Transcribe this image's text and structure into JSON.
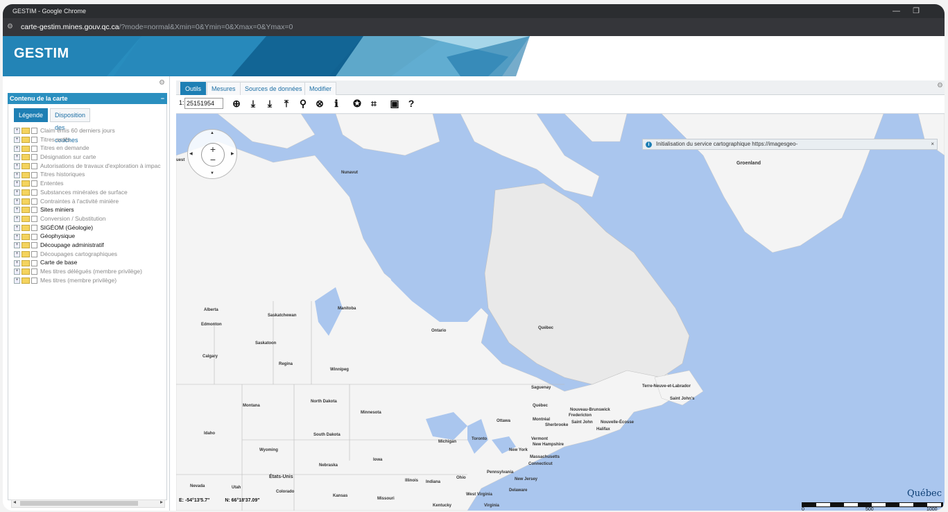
{
  "window": {
    "title": "GESTIM - Google Chrome",
    "minimize_icon": "minimize-icon",
    "restore_icon": "restore-icon"
  },
  "address": {
    "host": "carte-gestim.mines.gouv.qc.ca",
    "path": "/?mode=normal&Xmin=0&Ymin=0&Xmax=0&Ymax=0"
  },
  "banner": {
    "brand": "GESTIM",
    "colors": {
      "dark": "#0f5f8e",
      "mid": "#2a8fbf",
      "light": "#7fc6e2"
    }
  },
  "left_panel": {
    "title": "Contenu de la carte",
    "collapse_label": "−",
    "tabs": [
      {
        "label": "Légende",
        "active": true
      },
      {
        "label": "Disposition des couches",
        "active": false
      }
    ],
    "layers": [
      {
        "label": "Claim émis 60 derniers jours",
        "active": false
      },
      {
        "label": "Titres actifs",
        "active": false
      },
      {
        "label": "Titres en demande",
        "active": false
      },
      {
        "label": "Désignation sur carte",
        "active": false
      },
      {
        "label": "Autorisations de travaux d'exploration à impac",
        "active": false
      },
      {
        "label": "Titres historiques",
        "active": false
      },
      {
        "label": "Ententes",
        "active": false
      },
      {
        "label": "Substances minérales de surface",
        "active": false
      },
      {
        "label": "Contraintes à l'activité minière",
        "active": false
      },
      {
        "label": "Sites miniers",
        "active": true
      },
      {
        "label": "Conversion / Substitution",
        "active": false
      },
      {
        "label": "SIGÉOM (Géologie)",
        "active": true
      },
      {
        "label": "Géophysique",
        "active": true
      },
      {
        "label": "Découpage administratif",
        "active": true
      },
      {
        "label": "Découpages cartographiques",
        "active": false
      },
      {
        "label": "Carte de base",
        "active": true
      },
      {
        "label": "Mes titres délégués (membre privilège)",
        "active": false
      },
      {
        "label": "Mes titres (membre privilège)",
        "active": false
      }
    ]
  },
  "map_tabs": [
    {
      "label": "Outils",
      "active": true
    },
    {
      "label": "Mesures",
      "active": false
    },
    {
      "label": "Sources de données",
      "active": false
    },
    {
      "label": "Modifier",
      "active": false
    }
  ],
  "toolbar": {
    "scale_prefix": "1:",
    "scale_value": "25151954",
    "tools": [
      {
        "icon": "zoom-extent-icon",
        "glyph": "⊕"
      },
      {
        "icon": "download-icon",
        "glyph": "⤓"
      },
      {
        "icon": "download-alt-icon",
        "glyph": "⤓"
      },
      {
        "icon": "upload-icon",
        "glyph": "⤒"
      },
      {
        "icon": "search-icon",
        "glyph": "⚲"
      },
      {
        "icon": "zoom-search-icon",
        "glyph": "⊗"
      },
      {
        "icon": "info-icon",
        "glyph": "ℹ"
      },
      {
        "icon": "layers-add-icon",
        "glyph": "✪"
      },
      {
        "icon": "coordinates-icon",
        "glyph": "⌗"
      },
      {
        "icon": "pdf-icon",
        "glyph": "▣"
      },
      {
        "icon": "help-icon",
        "glyph": "?"
      }
    ]
  },
  "notice": {
    "text": "Initialisation du service cartographique https://imagesgeo-",
    "close": "×"
  },
  "map": {
    "labels": {
      "nunavut": "Nunavut",
      "groenland": "Groenland",
      "alberta": "Alberta",
      "saskatchewan": "Saskatchewan",
      "manitoba": "Manitoba",
      "ontario": "Ontario",
      "quebec": "Québec",
      "edmonton": "Edmonton",
      "saskatoon": "Saskatoon",
      "calgary": "Calgary",
      "regina": "Regina",
      "winnipeg": "Winnipeg",
      "montana": "Montana",
      "north_dakota": "North Dakota",
      "south_dakota": "South Dakota",
      "minnesota": "Minnesota",
      "idaho": "Idaho",
      "wyoming": "Wyoming",
      "nebraska": "Nebraska",
      "iowa": "Iowa",
      "etats_unis": "États-Unis",
      "nevada": "Nevada",
      "utah": "Utah",
      "colorado": "Colorado",
      "kansas": "Kansas",
      "missouri": "Missouri",
      "illinois": "Illinois",
      "indiana": "Indiana",
      "ohio": "Ohio",
      "kentucky": "Kentucky",
      "michigan": "Michigan",
      "toronto": "Toronto",
      "new_york": "New York",
      "pennsylvania": "Pennsylvania",
      "new_jersey": "New Jersey",
      "west_virginia": "West Virginia",
      "virginia": "Virginia",
      "delaware": "Delaware",
      "massachusetts": "Massachusetts",
      "connecticut": "Connecticut",
      "vermont": "Vermont",
      "new_hampshire": "New Hampshire",
      "montreal": "Montréal",
      "ottawa": "Ottawa",
      "quebec_city": "Québec",
      "sherbrooke": "Sherbrooke",
      "saguenay": "Saguenay",
      "nouveau_brunswick": "Nouveau-Brunswick",
      "nouvelle_ecosse": "Nouvelle-Écosse",
      "saint_john": "Saint John",
      "terre_neuve": "Terre-Neuve-et-Labrador",
      "saint_johns": "Saint John's",
      "fredericton": "Fredericton",
      "halifax": "Halifax",
      "west": "uest"
    },
    "coordinates": {
      "e": "E: -54°13'5.7\"",
      "n": "N: 66°18'37.09\""
    },
    "logo": "Québec",
    "scale_labels": [
      "0",
      "500",
      "1000"
    ],
    "colors": {
      "water": "#aac6ee",
      "land": "#f4f4f4",
      "quebec_land": "#e9e9e9"
    }
  }
}
